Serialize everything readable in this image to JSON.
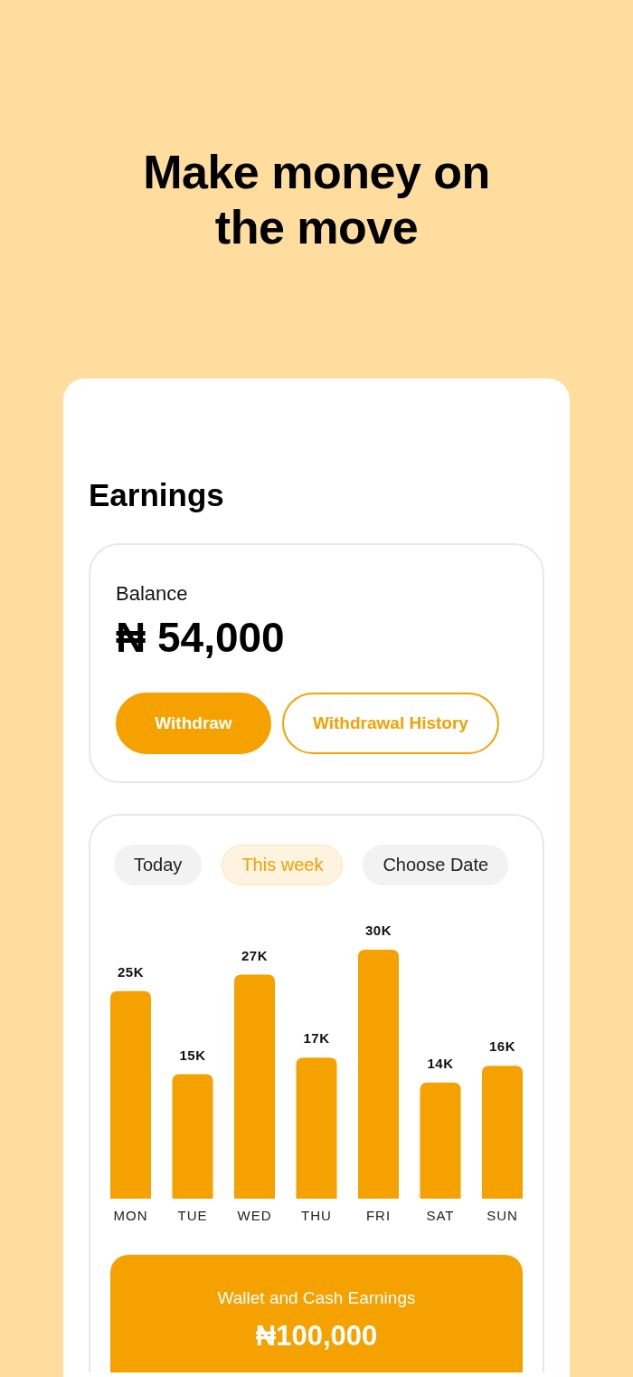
{
  "headline": "Make money on the move",
  "earnings": {
    "title": "Earnings",
    "balance": {
      "label": "Balance",
      "amount": "₦ 54,000",
      "buttons": [
        {
          "label": "Withdraw",
          "kind": "primary"
        },
        {
          "label": "Withdrawal History",
          "kind": "outline"
        }
      ]
    },
    "periods": [
      {
        "label": "Today",
        "selected": false
      },
      {
        "label": "This week",
        "selected": true
      },
      {
        "label": "Choose Date",
        "selected": false
      }
    ],
    "chart_data": {
      "type": "bar",
      "categories": [
        "MON",
        "TUE",
        "WED",
        "THU",
        "FRI",
        "SAT",
        "SUN"
      ],
      "values": [
        25000,
        15000,
        27000,
        17000,
        30000,
        14000,
        16000
      ],
      "value_labels": [
        "25K",
        "15K",
        "27K",
        "17K",
        "30K",
        "14K",
        "16K"
      ]
    },
    "total": {
      "label": "Wallet and Cash Earnings",
      "amount": "₦100,000"
    }
  }
}
